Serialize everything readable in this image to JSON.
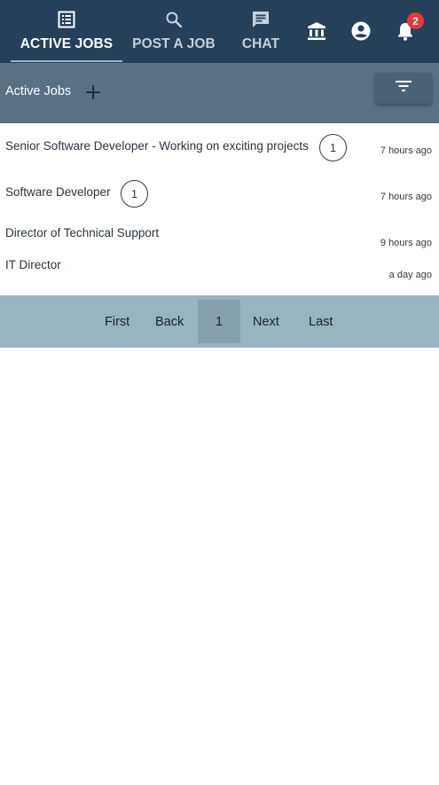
{
  "nav": {
    "tabs": [
      {
        "label": "ACTIVE JOBS",
        "icon": "list-icon",
        "active": true
      },
      {
        "label": "POST A JOB",
        "icon": "search-icon",
        "active": false
      },
      {
        "label": "CHAT",
        "icon": "chat-icon",
        "active": false
      }
    ],
    "icons": [
      "bank-icon",
      "account-icon",
      "bell-icon"
    ],
    "notification_count": "2",
    "colors": {
      "background": "#26405a",
      "badge": "#e53935"
    }
  },
  "section": {
    "title": "Active Jobs",
    "add_icon": "plus-icon",
    "filter_icon": "filter-icon",
    "background": "#5a7184"
  },
  "jobs": [
    {
      "title": "Senior Software Developer - Working on exciting projects",
      "count": "1",
      "time": "7 hours ago"
    },
    {
      "title": "Software Developer",
      "count": "1",
      "time": "7 hours ago"
    },
    {
      "title": "Director of Technical Support",
      "count": "",
      "time": "9 hours ago"
    },
    {
      "title": "IT Director",
      "count": "",
      "time": "a day ago"
    }
  ],
  "pagination": {
    "first": "First",
    "back": "Back",
    "current": "1",
    "next": "Next",
    "last": "Last",
    "background": "#98b4bf"
  }
}
